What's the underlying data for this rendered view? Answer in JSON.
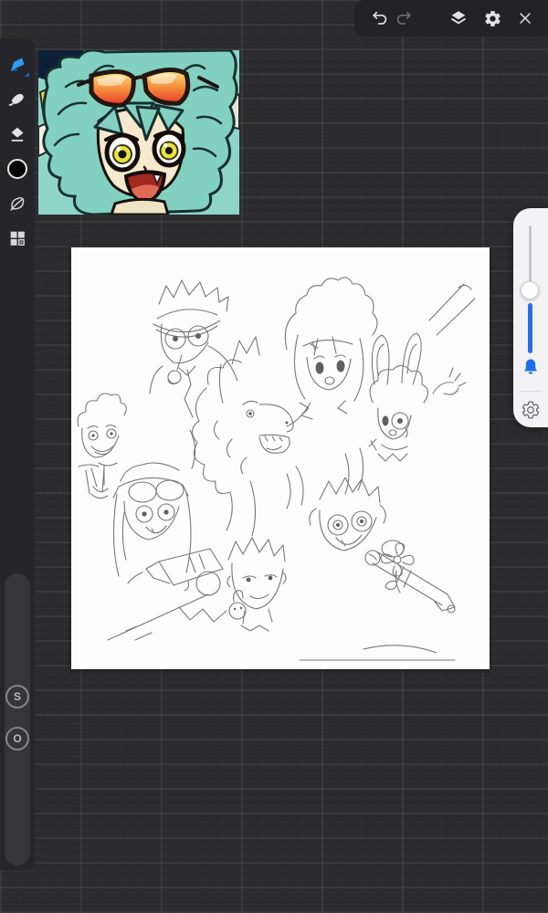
{
  "app": {
    "background_color": "#2c2c2e",
    "canvas_color": "#ffffff"
  },
  "top_toolbar": {
    "icons": [
      {
        "name": "undo",
        "enabled": true
      },
      {
        "name": "redo",
        "enabled": false
      },
      {
        "name": "layers",
        "enabled": true
      },
      {
        "name": "settings",
        "enabled": true
      },
      {
        "name": "close",
        "enabled": true
      }
    ]
  },
  "left_toolbar": {
    "tools": [
      {
        "name": "brush",
        "active": true,
        "accent_color": "#2f9bef"
      },
      {
        "name": "smudge",
        "active": false
      },
      {
        "name": "eraser",
        "active": false
      },
      {
        "name": "color-swatch",
        "current_color": "#000000"
      },
      {
        "name": "leaf-effects",
        "active": false
      },
      {
        "name": "gallery-grid",
        "active": false
      }
    ]
  },
  "edge_sliders": {
    "size_label": "S",
    "opacity_label": "O"
  },
  "right_panel": {
    "slider_accent": "#2e6ce6",
    "bell_color": "#1d6cf2",
    "icons": [
      "bell",
      "settings-outline"
    ]
  },
  "reference_image": {
    "description": "anime face with teal hair, yellow eyes and orange gradient sunglasses"
  },
  "canvas": {
    "description": "pencil line-art sketch of a group of anime characters with water guns"
  }
}
